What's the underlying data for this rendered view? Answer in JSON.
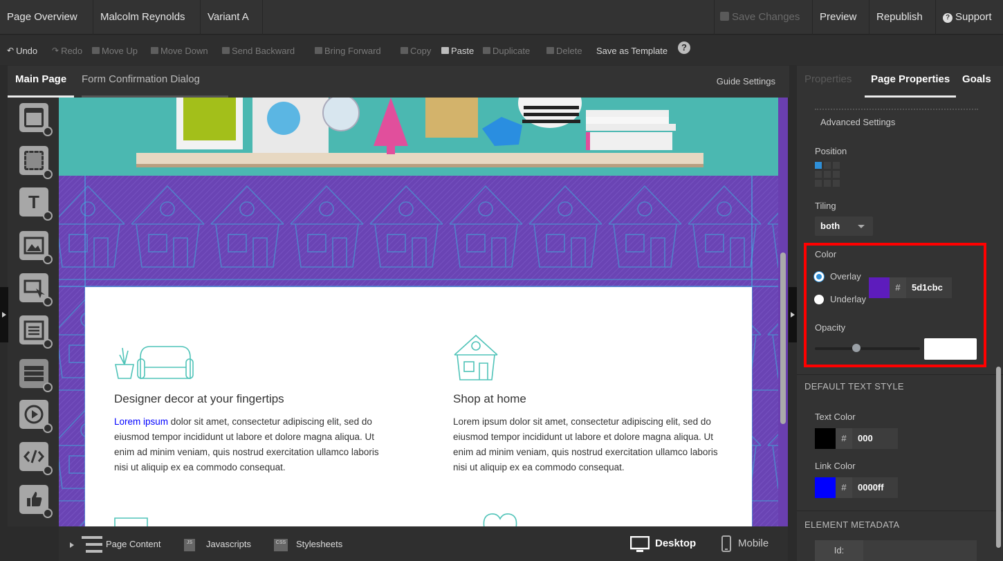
{
  "topbar": {
    "page_overview": "Page Overview",
    "page_name": "Malcolm Reynolds",
    "variant": "Variant A",
    "save_changes": "Save Changes",
    "preview": "Preview",
    "republish": "Republish",
    "support": "Support"
  },
  "toolbar": {
    "undo": "Undo",
    "redo": "Redo",
    "move_up": "Move Up",
    "move_down": "Move Down",
    "send_backward": "Send Backward",
    "bring_forward": "Bring Forward",
    "copy": "Copy",
    "paste": "Paste",
    "duplicate": "Duplicate",
    "delete": "Delete",
    "save_as_template": "Save as Template",
    "help": "?"
  },
  "editor_tabs": {
    "main_page": "Main Page",
    "form_confirmation": "Form Confirmation Dialog",
    "guide_settings": "Guide Settings"
  },
  "palette": {
    "text_glyph": "T"
  },
  "canvas": {
    "card1": {
      "title": "Designer decor at your fingertips",
      "link": "Lorem ipsum",
      "text": " dolor sit amet, consectetur adipiscing elit, sed do eiusmod tempor incididunt ut labore et dolore magna aliqua. Ut enim ad minim veniam, quis nostrud exercitation ullamco laboris nisi ut aliquip ex ea commodo consequat."
    },
    "card2": {
      "title": "Shop at home",
      "text": "Lorem ipsum dolor sit amet, consectetur adipiscing elit, sed do eiusmod tempor incididunt ut labore et dolore magna aliqua. Ut enim ad minim veniam, quis nostrud exercitation ullamco laboris nisi ut aliquip ex ea commodo consequat."
    },
    "colors": {
      "hero": "#4bb8b1",
      "purple": "#6a44b4",
      "icon_stroke": "#4fc3b8"
    }
  },
  "bottombar": {
    "page_content": "Page Content",
    "javascripts": "Javascripts",
    "js_badge": "JS",
    "stylesheets": "Stylesheets",
    "css_badge": "CSS",
    "desktop": "Desktop",
    "mobile": "Mobile"
  },
  "right_panel": {
    "tabs": {
      "properties": "Properties",
      "page_properties": "Page Properties",
      "goals": "Goals"
    },
    "advanced_settings": "Advanced Settings",
    "position": "Position",
    "tiling": {
      "label": "Tiling",
      "value": "both"
    },
    "color": {
      "label": "Color",
      "overlay": "Overlay",
      "underlay": "Underlay",
      "hash": "#",
      "hex": "5d1cbc",
      "swatch": "#5d1cbc"
    },
    "opacity": {
      "label": "Opacity",
      "value": ""
    },
    "default_text_style": "DEFAULT TEXT STYLE",
    "text_color": {
      "label": "Text Color",
      "hash": "#",
      "hex": "000",
      "swatch": "#000000"
    },
    "link_color": {
      "label": "Link Color",
      "hash": "#",
      "hex": "0000ff",
      "swatch": "#0000ff"
    },
    "element_metadata": "ELEMENT METADATA",
    "id_label": "Id:"
  }
}
